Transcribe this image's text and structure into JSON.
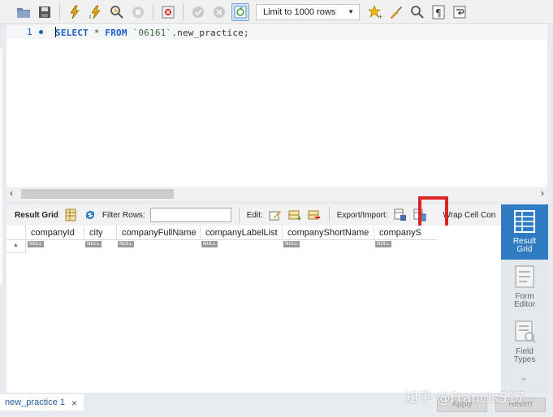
{
  "toolbar": {
    "limit_rows": "Limit to 1000 rows",
    "icons": [
      "open-folder-icon",
      "save-icon",
      "execute-icon",
      "execute-current-icon",
      "explain-icon",
      "stop-icon",
      "toggle-error-icon",
      "commit-icon",
      "rollback-icon",
      "autocommit-icon",
      "bookmark-icon",
      "beautify-icon",
      "find-icon",
      "invisible-chars-icon",
      "word-wrap-icon"
    ]
  },
  "editor": {
    "line_number": "1",
    "sql": {
      "kw1": "SELECT",
      "star": " * ",
      "kw2": "FROM",
      "schema": " `06161`",
      "table": ".new_practice;"
    }
  },
  "results": {
    "result_grid_label": "Result Grid",
    "filter_rows_label": "Filter Rows:",
    "filter_value": "",
    "edit_label": "Edit:",
    "export_import_label": "Export/Import:",
    "wrap_cell_label": "Wrap Cell Con",
    "columns": [
      "companyId",
      "city",
      "companyFullName",
      "companyLabelList",
      "companyShortName",
      "companyS"
    ],
    "null_text": "NULL",
    "new_row_marker": "*"
  },
  "side_panel": {
    "items": [
      {
        "label1": "Result",
        "label2": "Grid"
      },
      {
        "label1": "Form",
        "label2": "Editor"
      },
      {
        "label1": "Field",
        "label2": "Types"
      }
    ]
  },
  "bottom": {
    "tab_label": "new_practice 1",
    "tab_close": "×",
    "apply_label": "Apply",
    "revert_label": "Revert",
    "watermark": "知乎 @Francis517"
  },
  "colors": {
    "accent": "#2f7cc2",
    "highlight": "#e02424",
    "keyword": "#1a5fc4"
  }
}
